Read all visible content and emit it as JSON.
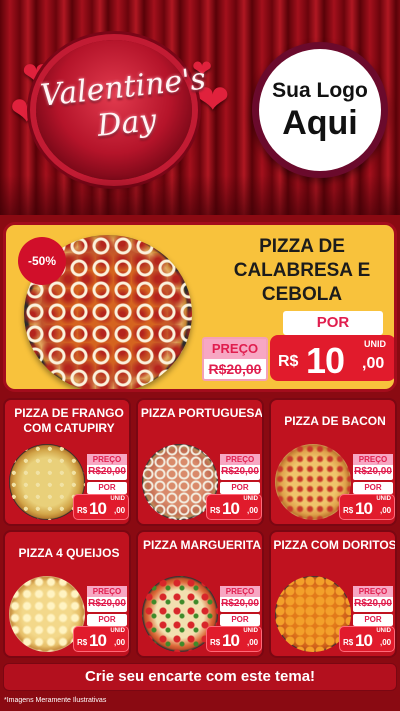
{
  "header": {
    "valentine_title_line1": "Valentine's",
    "valentine_title_line2": "Day",
    "logo_line1": "Sua Logo",
    "logo_line2": "Aqui"
  },
  "featured": {
    "discount": "-50%",
    "title": "PIZZA DE CALABRESA E CEBOLA",
    "preco_label": "PREÇO",
    "old_price": "R$20,00",
    "por_label": "POR",
    "unit": "UNID",
    "currency": "R$",
    "price_int": "10",
    "price_cents": ",00"
  },
  "products": [
    {
      "name": "PIZZA DE FRANGO COM CATUPIRY",
      "preco_label": "PREÇO",
      "old_price": "R$20,00",
      "por_label": "POR",
      "unit": "UNID",
      "currency": "R$",
      "price_int": "10",
      "price_cents": ",00"
    },
    {
      "name": "PIZZA PORTUGUESA",
      "preco_label": "PREÇO",
      "old_price": "R$20,00",
      "por_label": "POR",
      "unit": "UNID",
      "currency": "R$",
      "price_int": "10",
      "price_cents": ",00"
    },
    {
      "name": "PIZZA DE BACON",
      "preco_label": "PREÇO",
      "old_price": "R$20,00",
      "por_label": "POR",
      "unit": "UNID",
      "currency": "R$",
      "price_int": "10",
      "price_cents": ",00"
    },
    {
      "name": "PIZZA 4 QUEIJOS",
      "preco_label": "PREÇO",
      "old_price": "R$20,00",
      "por_label": "POR",
      "unit": "UNID",
      "currency": "R$",
      "price_int": "10",
      "price_cents": ",00"
    },
    {
      "name": "PIZZA MARGUERITA",
      "preco_label": "PREÇO",
      "old_price": "R$20,00",
      "por_label": "POR",
      "unit": "UNID",
      "currency": "R$",
      "price_int": "10",
      "price_cents": ",00"
    },
    {
      "name": "PIZZA COM DORITOS",
      "preco_label": "PREÇO",
      "old_price": "R$20,00",
      "por_label": "POR",
      "unit": "UNID",
      "currency": "R$",
      "price_int": "10",
      "price_cents": ",00"
    }
  ],
  "cta": "Crie seu encarte com este tema!",
  "disclaimer": "*Imagens Meramente Ilustrativas",
  "colors": {
    "background": "#8a0a12",
    "featured_bg": "#f8c23c",
    "card_bg": "#c0121f",
    "price_red": "#e11b2c",
    "preco_pink": "#f7a7c3"
  }
}
